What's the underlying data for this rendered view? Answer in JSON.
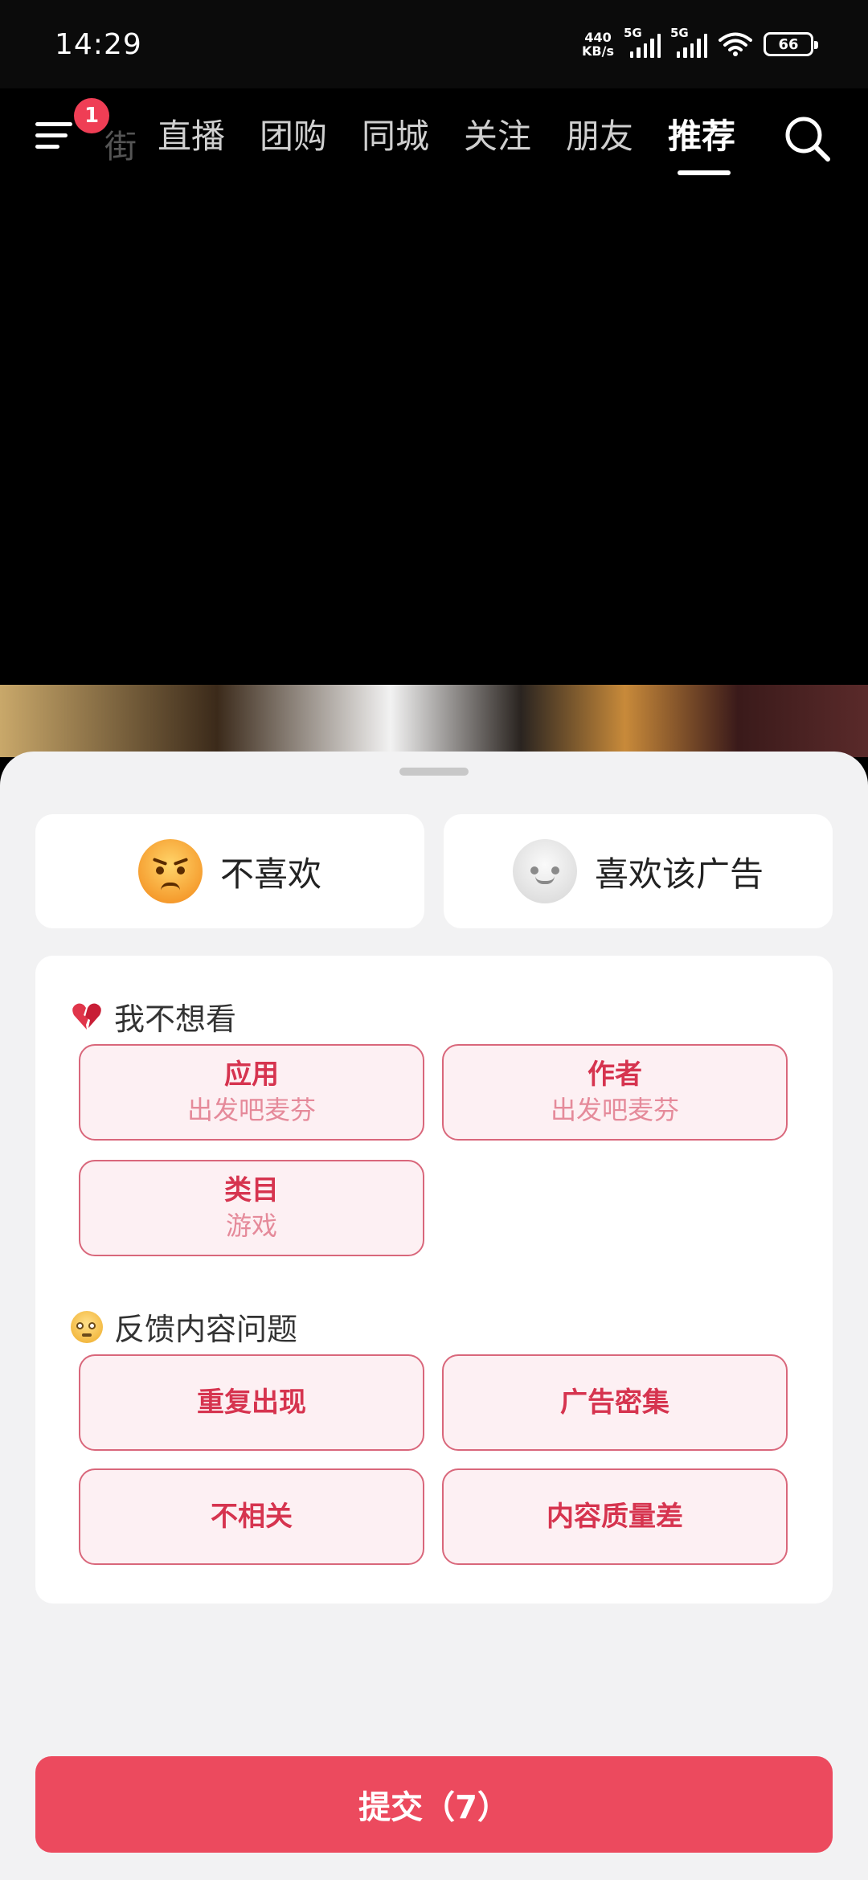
{
  "status_bar": {
    "time": "14:29",
    "net_speed_value": "440",
    "net_speed_unit": "KB/s",
    "signal1_label": "5G",
    "signal2_label": "5G",
    "battery": "66"
  },
  "nav": {
    "badge_count": "1",
    "faded_tab": "街",
    "tabs": [
      "直播",
      "团购",
      "同城",
      "关注",
      "朋友",
      "推荐"
    ],
    "active_tab": "推荐"
  },
  "reactions": {
    "dislike_label": "不喜欢",
    "like_label": "喜欢该广告"
  },
  "not_interested": {
    "title": "我不想看",
    "options": [
      {
        "main": "应用",
        "sub": "出发吧麦芬"
      },
      {
        "main": "作者",
        "sub": "出发吧麦芬"
      },
      {
        "main": "类目",
        "sub": "游戏"
      }
    ]
  },
  "feedback": {
    "title": "反馈内容问题",
    "options": [
      {
        "main": "重复出现"
      },
      {
        "main": "广告密集"
      },
      {
        "main": "不相关"
      },
      {
        "main": "内容质量差"
      }
    ]
  },
  "submit_label": "提交（7）",
  "colors": {
    "accent": "#ec4a5e",
    "option_border": "#d9677b",
    "option_bg": "#fdf0f3",
    "badge": "#ef3e55"
  }
}
